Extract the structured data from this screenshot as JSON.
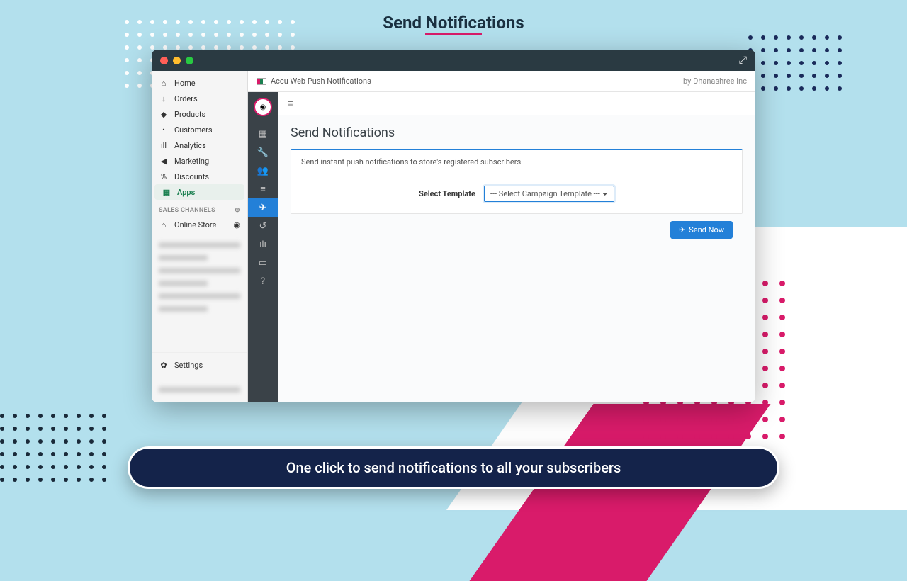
{
  "page": {
    "title": "Send Notifications",
    "bottom_caption": "One click to send notifications to all your subscribers"
  },
  "header": {
    "app_name": "Accu Web Push Notifications",
    "vendor": "by Dhanashree Inc"
  },
  "shopify_nav": {
    "home": "Home",
    "orders": "Orders",
    "products": "Products",
    "customers": "Customers",
    "analytics": "Analytics",
    "marketing": "Marketing",
    "discounts": "Discounts",
    "apps": "Apps",
    "sales_channels": "SALES CHANNELS",
    "online_store": "Online Store",
    "settings": "Settings"
  },
  "panel": {
    "title": "Send Notifications",
    "description": "Send instant push notifications to store's registered subscribers",
    "template_label": "Select Template",
    "template_placeholder": "--- Select Campaign Template ---",
    "send_button": "Send Now"
  }
}
